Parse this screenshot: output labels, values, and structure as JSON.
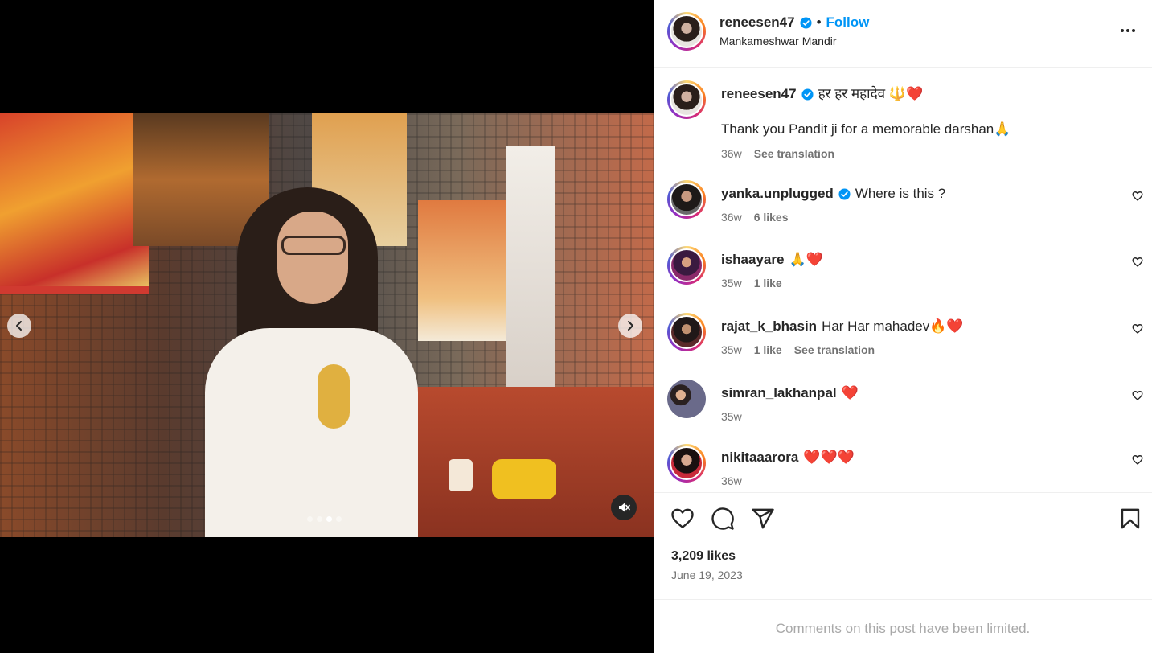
{
  "post": {
    "username": "reneesen47",
    "follow_label": "Follow",
    "bullet": "•",
    "location": "Mankameshwar Mandir",
    "caption_line1": "हर हर महादेव 🔱❤️",
    "caption_line2": "Thank you Pandit ji for a memorable darshan🙏",
    "caption_time": "36w",
    "see_translation": "See translation"
  },
  "comments": [
    {
      "username": "yanka.unplugged",
      "verified": true,
      "text": "Where is this ?",
      "time": "36w",
      "likes": "6 likes",
      "translation": ""
    },
    {
      "username": "ishaayare",
      "verified": false,
      "text": "🙏❤️",
      "time": "35w",
      "likes": "1 like",
      "translation": ""
    },
    {
      "username": "rajat_k_bhasin",
      "verified": false,
      "text": "Har Har mahadev🔥❤️",
      "time": "35w",
      "likes": "1 like",
      "translation": "See translation"
    },
    {
      "username": "simran_lakhanpal",
      "verified": false,
      "text": "❤️",
      "time": "35w",
      "likes": "",
      "translation": ""
    },
    {
      "username": "nikitaaarora",
      "verified": false,
      "text": "❤️❤️❤️",
      "time": "36w",
      "likes": "",
      "translation": ""
    }
  ],
  "footer": {
    "likes_count": "3,209 likes",
    "date": "June 19, 2023",
    "limited_notice": "Comments on this post have been limited."
  },
  "carousel": {
    "slides": 4,
    "active_index": 2
  },
  "icons": {
    "verified": "verified-badge-icon",
    "more": "more-options-icon",
    "like": "heart-icon",
    "comment": "comment-icon",
    "share": "share-icon",
    "save": "bookmark-icon",
    "mute": "muted-speaker-icon",
    "prev": "chevron-left-icon",
    "next": "chevron-right-icon"
  },
  "colors": {
    "accent": "#0095f6",
    "verified": "#0095f6",
    "muted_text": "#737373"
  }
}
